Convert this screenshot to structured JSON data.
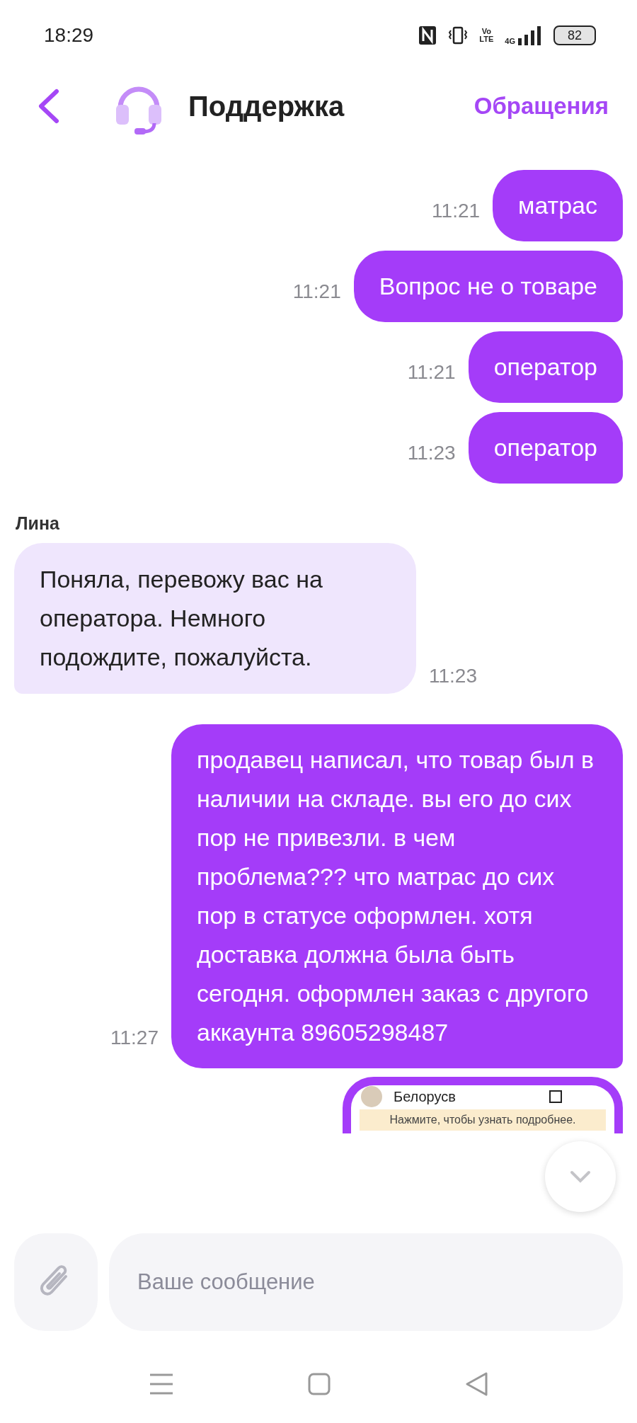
{
  "status_bar": {
    "time": "18:29",
    "volte": [
      "Vo",
      "LTE"
    ],
    "network": "4G",
    "battery": "82"
  },
  "header": {
    "title": "Поддержка",
    "action": "Обращения"
  },
  "messages": [
    {
      "kind": "outgoing",
      "text": "матрас",
      "time": "11:21"
    },
    {
      "kind": "outgoing",
      "text": "Вопрос не о товаре",
      "time": "11:21"
    },
    {
      "kind": "outgoing",
      "text": "оператор",
      "time": "11:21"
    },
    {
      "kind": "outgoing",
      "text": "оператор",
      "time": "11:23"
    },
    {
      "kind": "incoming",
      "sender": "Лина",
      "text": "Поняла, перевожу вас на оператора. Немного подождите, пожалуйста.",
      "time": "11:23"
    },
    {
      "kind": "outgoing",
      "text": "продавец написал, что товар был в наличии на складе. вы его до сих пор не привезли. в чем проблема??? что матрас до сих пор в статусе оформлен. хотя доставка должна была быть сегодня. оформлен заказ с другого аккаунта 89605298487",
      "time": "11:27"
    },
    {
      "kind": "image",
      "name": "Белорусв",
      "notice": "Нажмите, чтобы узнать подробнее."
    }
  ],
  "composer": {
    "placeholder": "Ваше сообщение"
  }
}
